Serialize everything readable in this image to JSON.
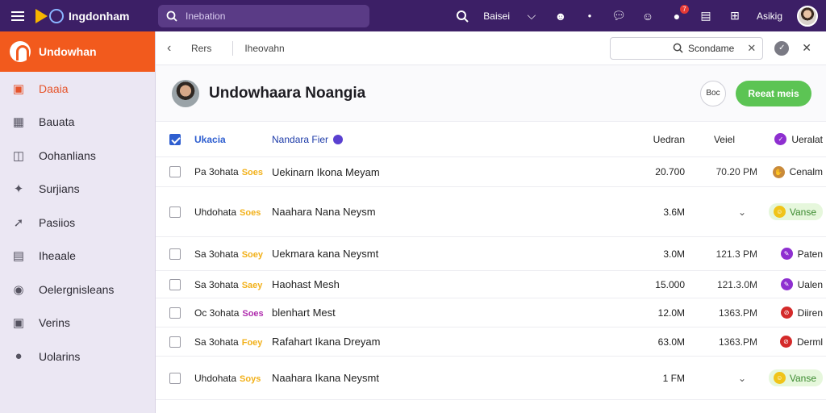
{
  "colors": {
    "topbar": "#3c1f66",
    "accent": "#f25a1d",
    "primary_button": "#5cc454"
  },
  "topbar": {
    "brand_name": "Ingdonham",
    "search_placeholder": "Inebation",
    "action_label": "Baisei",
    "profile_label": "Asikig",
    "notification_count": "7"
  },
  "sidebar": {
    "header": "Undowhan",
    "items": [
      {
        "label": "Daaia",
        "icon": "gift-icon",
        "active": true
      },
      {
        "label": "Bauata",
        "icon": "image-icon"
      },
      {
        "label": "Oohanlians",
        "icon": "grid-icon"
      },
      {
        "label": "Surjians",
        "icon": "sparkle-icon"
      },
      {
        "label": "Pasiios",
        "icon": "pin-icon"
      },
      {
        "label": "Iheaale",
        "icon": "document-icon"
      },
      {
        "label": "Oelergnisleans",
        "icon": "mail-icon"
      },
      {
        "label": "Verins",
        "icon": "gamepad-icon"
      },
      {
        "label": "Uolarins",
        "icon": "audio-icon"
      }
    ]
  },
  "toolbar": {
    "back_label": "Rers",
    "breadcrumb": "Iheovahn",
    "find_label": "Scondame"
  },
  "header": {
    "title": "Undowhaara Noangia",
    "ghost_button": "Boc",
    "primary_button": "Reeat meis"
  },
  "table": {
    "columns": {
      "id": "Ukacia",
      "name": "Nandara Fier",
      "value": "Uedran",
      "time": "Veiel",
      "status": "Ueralat"
    },
    "rows": [
      {
        "id": "Pa 3ohata",
        "tag": "Soes",
        "tag_color": "#f2b11b",
        "name": "Uekinarn Ikona Meyam",
        "value": "20.700",
        "time": "70.20 PM",
        "status": "Cenalm",
        "status_icon": "hand-icon",
        "status_color": "#c98a3a",
        "style": "plain"
      },
      {
        "id": "Uhdohata",
        "tag": "Soes",
        "tag_color": "#f2b11b",
        "name": "Naahara Nana Neysm",
        "value": "3.6M",
        "time": "",
        "status": "Vanse",
        "status_icon": "smile-icon",
        "status_color": "#f0c419",
        "style": "pill"
      },
      {
        "id": "Sa 3ohata",
        "tag": "Soey",
        "tag_color": "#f2b11b",
        "name": "Uekmara kana Neysmt",
        "value": "3.0M",
        "time": "121.3 PM",
        "status": "Paten",
        "status_icon": "pen-icon",
        "status_color": "#8e2fd0",
        "style": "plain"
      },
      {
        "id": "Sa 3ohata",
        "tag": "Saey",
        "tag_color": "#f2b11b",
        "name": "Haohast Mesh",
        "value": "15.000",
        "time": "121.3.0M",
        "status": "Ualen",
        "status_icon": "pen-icon",
        "status_color": "#8e2fd0",
        "style": "plain"
      },
      {
        "id": "Oc 3ohata",
        "tag": "Soes",
        "tag_color": "#b02fae",
        "name": "blenhart Mest",
        "value": "12.0M",
        "time": "1363.PM",
        "status": "Diiren",
        "status_icon": "block-icon",
        "status_color": "#d42a2a",
        "style": "plain"
      },
      {
        "id": "Sa 3ohata",
        "tag": "Foey",
        "tag_color": "#f2b11b",
        "name": "Rafahart Ikana Dreyam",
        "value": "63.0M",
        "time": "1363.PM",
        "status": "Derml",
        "status_icon": "block-icon",
        "status_color": "#d42a2a",
        "style": "plain"
      },
      {
        "id": "Uhdohata",
        "tag": "Soys",
        "tag_color": "#f2b11b",
        "name": "Naahara Ikana Neysmt",
        "value": "1 FM",
        "time": "",
        "status": "Vanse",
        "status_icon": "smile-icon",
        "status_color": "#f0c419",
        "style": "pill"
      }
    ]
  }
}
